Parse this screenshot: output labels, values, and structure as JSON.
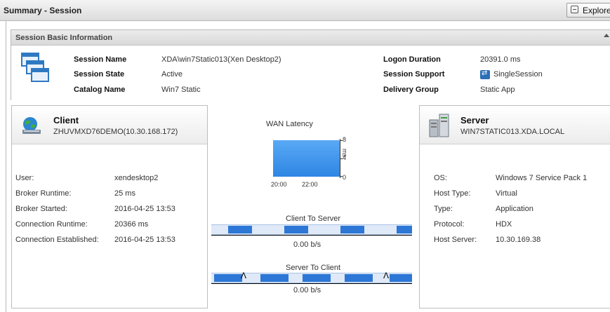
{
  "window": {
    "title": "Summary - Session",
    "explore_label": "Explore"
  },
  "basic_info": {
    "title": "Session Basic Information",
    "fields_left": [
      {
        "label": "Session Name",
        "value": "XDA\\win7Static013(Xen Desktop2)"
      },
      {
        "label": "Session State",
        "value": "Active"
      },
      {
        "label": "Catalog Name",
        "value": "Win7 Static"
      }
    ],
    "fields_right": [
      {
        "label": "Logon Duration",
        "value": "20391.0 ms"
      },
      {
        "label": "Session Support",
        "value": "SingleSession"
      },
      {
        "label": "Delivery Group",
        "value": "Static App"
      }
    ]
  },
  "client": {
    "name": "Client",
    "host": "ZHUVMXD76DEMO(10.30.168.172)",
    "rows": [
      {
        "label": "User:",
        "value": "xendesktop2"
      },
      {
        "label": "Broker Runtime:",
        "value": "25 ms"
      },
      {
        "label": "Broker Started:",
        "value": "2016-04-25 13:53"
      },
      {
        "label": "Connection Runtime:",
        "value": "20366 ms"
      },
      {
        "label": "Connection Established:",
        "value": "2016-04-25 13:53"
      }
    ]
  },
  "wan": {
    "title": "WAN Latency",
    "x_ticks": [
      "20:00",
      "22:00"
    ],
    "y_ticks": [
      "8",
      "4",
      "0"
    ],
    "unit": "ms"
  },
  "client_to_server": {
    "title": "Client To Server",
    "rate": "0.00 b/s"
  },
  "server_to_client": {
    "title": "Server To Client",
    "rate": "0.00 b/s"
  },
  "server": {
    "name": "Server",
    "host": "WIN7STATIC013.XDA.LOCAL",
    "rows": [
      {
        "label": "OS:",
        "value": "Windows 7 Service Pack 1"
      },
      {
        "label": "Host Type:",
        "value": "Virtual"
      },
      {
        "label": "Type:",
        "value": "Application"
      },
      {
        "label": "Protocol:",
        "value": "HDX"
      },
      {
        "label": "Host Server:",
        "value": "10.30.169.38"
      }
    ]
  },
  "colors": {
    "accent": "#2d77d6",
    "chart_fill": "#3d95ee",
    "header_bg": "#dcdcdc"
  }
}
